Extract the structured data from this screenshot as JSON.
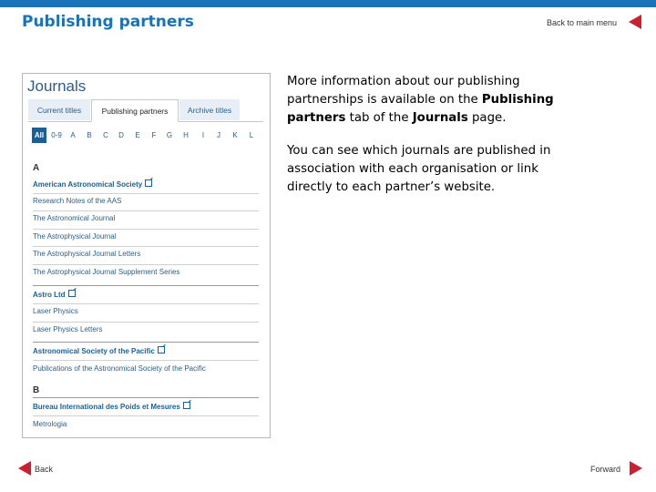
{
  "header": {
    "title": "Publishing partners",
    "back_to_menu": "Back to main menu",
    "accent_color": "#1a73b8",
    "nav_arrow_color": "#cc1f2f"
  },
  "panel": {
    "title": "Journals",
    "tabs": [
      "Current titles",
      "Publishing partners",
      "Archive titles"
    ],
    "active_tab": "Publishing partners",
    "letters": [
      "All",
      "0-9",
      "A",
      "B",
      "C",
      "D",
      "E",
      "F",
      "G",
      "H",
      "I",
      "J",
      "K",
      "L"
    ],
    "active_letter": "All",
    "sections": [
      {
        "head": "A"
      },
      {
        "head": "B"
      }
    ],
    "orgs": [
      "American Astronomical Society",
      "Astro Ltd",
      "Astronomical Society of the Pacific",
      "Bureau International des Poids et Mesures"
    ],
    "journals": [
      "Research Notes of the AAS",
      "The Astronomical Journal",
      "The Astrophysical Journal",
      "The Astrophysical Journal Letters",
      "The Astrophysical Journal Supplement Series",
      "Laser Physics",
      "Laser Physics Letters",
      "Publications of the Astronomical Society of the Pacific",
      "Metrologia"
    ]
  },
  "text": {
    "p1_before": "More information about our publishing partnerships is available on the ",
    "p1_bold1": "Publishing partners",
    "p1_mid": " tab of the ",
    "p1_bold2": "Journals",
    "p1_after": " page.",
    "p2": "You can see which journals are published in association with each organisation or link directly to each partner’s website."
  },
  "nav": {
    "back": "Back",
    "forward": "Forward"
  }
}
